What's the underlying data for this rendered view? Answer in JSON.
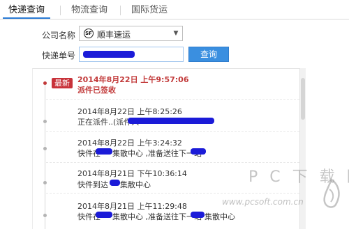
{
  "tabs": [
    {
      "label": "快递查询",
      "active": true
    },
    {
      "label": "物流查询",
      "active": false
    },
    {
      "label": "国际货运",
      "active": false
    }
  ],
  "form": {
    "company_label": "公司名称",
    "company_value": "顺丰速运",
    "company_logo_text": "SF",
    "tracking_label": "快递单号",
    "query_button": "查询"
  },
  "results": {
    "latest_badge": "最新",
    "entries": [
      {
        "time": "2014年8月22日 上午9:57:06",
        "desc": "派件已签收",
        "latest": true
      },
      {
        "time": "2014年8月22日 上午8:25:26",
        "desc": "正在派件..(派件人",
        "latest": false
      },
      {
        "time": "2014年8月22日 上午3:24:32",
        "desc_prefix": "快件在",
        "desc_mid": "集散中心 ,准备送往下一站",
        "latest": false
      },
      {
        "time": "2014年8月21日 下午10:36:14",
        "desc_prefix": "快件到达",
        "desc_mid": "集散中心",
        "latest": false
      },
      {
        "time": "2014年8月21日 上午11:29:48",
        "desc_prefix": "快件在",
        "desc_mid": "集散中心 ,准备送往下一站",
        "desc_suffix": "集散中心",
        "latest": false
      }
    ]
  },
  "watermark": {
    "title": "P C 下 载 网",
    "url": "www.pcsoft.com.cn"
  },
  "colors": {
    "accent": "#3a8fe0",
    "latest": "#c23a3a",
    "redaction": "#1b1bd8"
  }
}
